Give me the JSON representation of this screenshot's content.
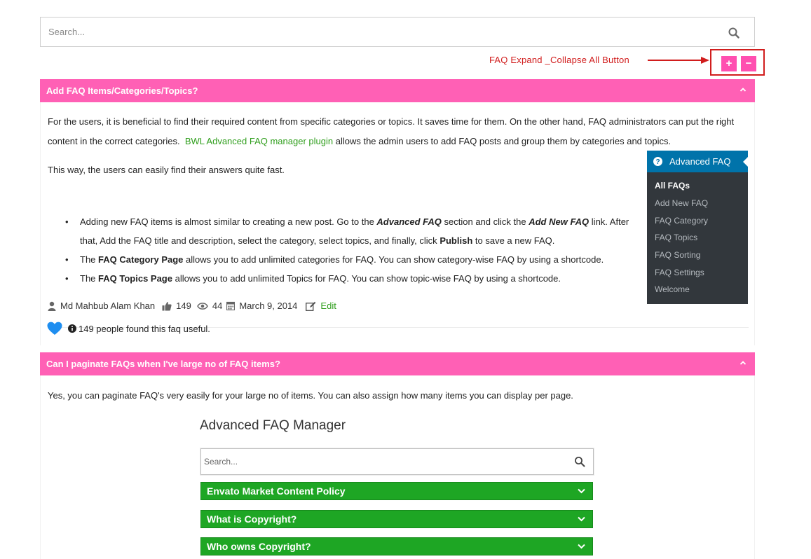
{
  "search": {
    "placeholder": "Search..."
  },
  "annotation": {
    "label": "FAQ Expand _Collapse All Button"
  },
  "controls": {
    "expand": "+",
    "collapse": "−"
  },
  "faq1": {
    "title": "Add FAQ Items/Categories/Topics?",
    "para1_a": "For the users, it is beneficial to find their required content from specific categories or topics. It saves time for them. On the other hand, FAQ administrators can put the right",
    "para1_b": "content in the correct categories.",
    "para1_link": "BWL Advanced FAQ manager plugin",
    "para1_c": "allows the admin users to add FAQ posts and group them by categories and topics.",
    "para2": "This way, the users can easily find their answers quite fast.",
    "bullet1_a": "Adding new FAQ items is almost similar to creating a new post. Go to the",
    "bullet1_b": "Advanced FAQ",
    "bullet1_c": "section and click the",
    "bullet1_d": "Add New FAQ",
    "bullet1_e": "link. After",
    "bullet1_f": "that, Add the FAQ title and description, select the category, select topics, and finally, click",
    "bullet1_g": "Publish",
    "bullet1_h": "to save a new FAQ.",
    "bullet2_a": "The",
    "bullet2_b": "FAQ Category Page",
    "bullet2_c": "allows you to add unlimited categories for FAQ. You can show category-wise FAQ by using a shortcode.",
    "bullet3_a": "The",
    "bullet3_b": "FAQ Topics Page",
    "bullet3_c": "allows you to add unlimited Topics for FAQ. You can show topic-wise FAQ by using a shortcode.",
    "meta": {
      "author": "Md Mahbub Alam Khan",
      "likes": "149",
      "views": "44",
      "date": "March 9, 2014",
      "edit": "Edit"
    },
    "useful": "149 people found this faq useful."
  },
  "wp_menu": {
    "title": "Advanced FAQ",
    "items": [
      "All FAQs",
      "Add New FAQ",
      "FAQ Category",
      "FAQ Topics",
      "FAQ Sorting",
      "FAQ Settings",
      "Welcome"
    ]
  },
  "faq2": {
    "title": "Can I paginate FAQs when I've large no of FAQ items?",
    "para": "Yes, you can paginate FAQ's very easily for your large no of items. You can also assign how many items you can display per page."
  },
  "screenshot": {
    "title": "Advanced FAQ Manager",
    "search_placeholder": "Search...",
    "rows": [
      "Envato Market Content Policy",
      "What is Copyright?",
      "Who owns Copyright?"
    ]
  },
  "colors": {
    "header_pink": "#ff60b5",
    "button_pink": "#ff4fb0",
    "link_green": "#2f9e1c",
    "annotation_red": "#d11d1d",
    "wp_dark": "#32373c",
    "wp_blue": "#0073aa",
    "row_green": "#1ea624"
  }
}
